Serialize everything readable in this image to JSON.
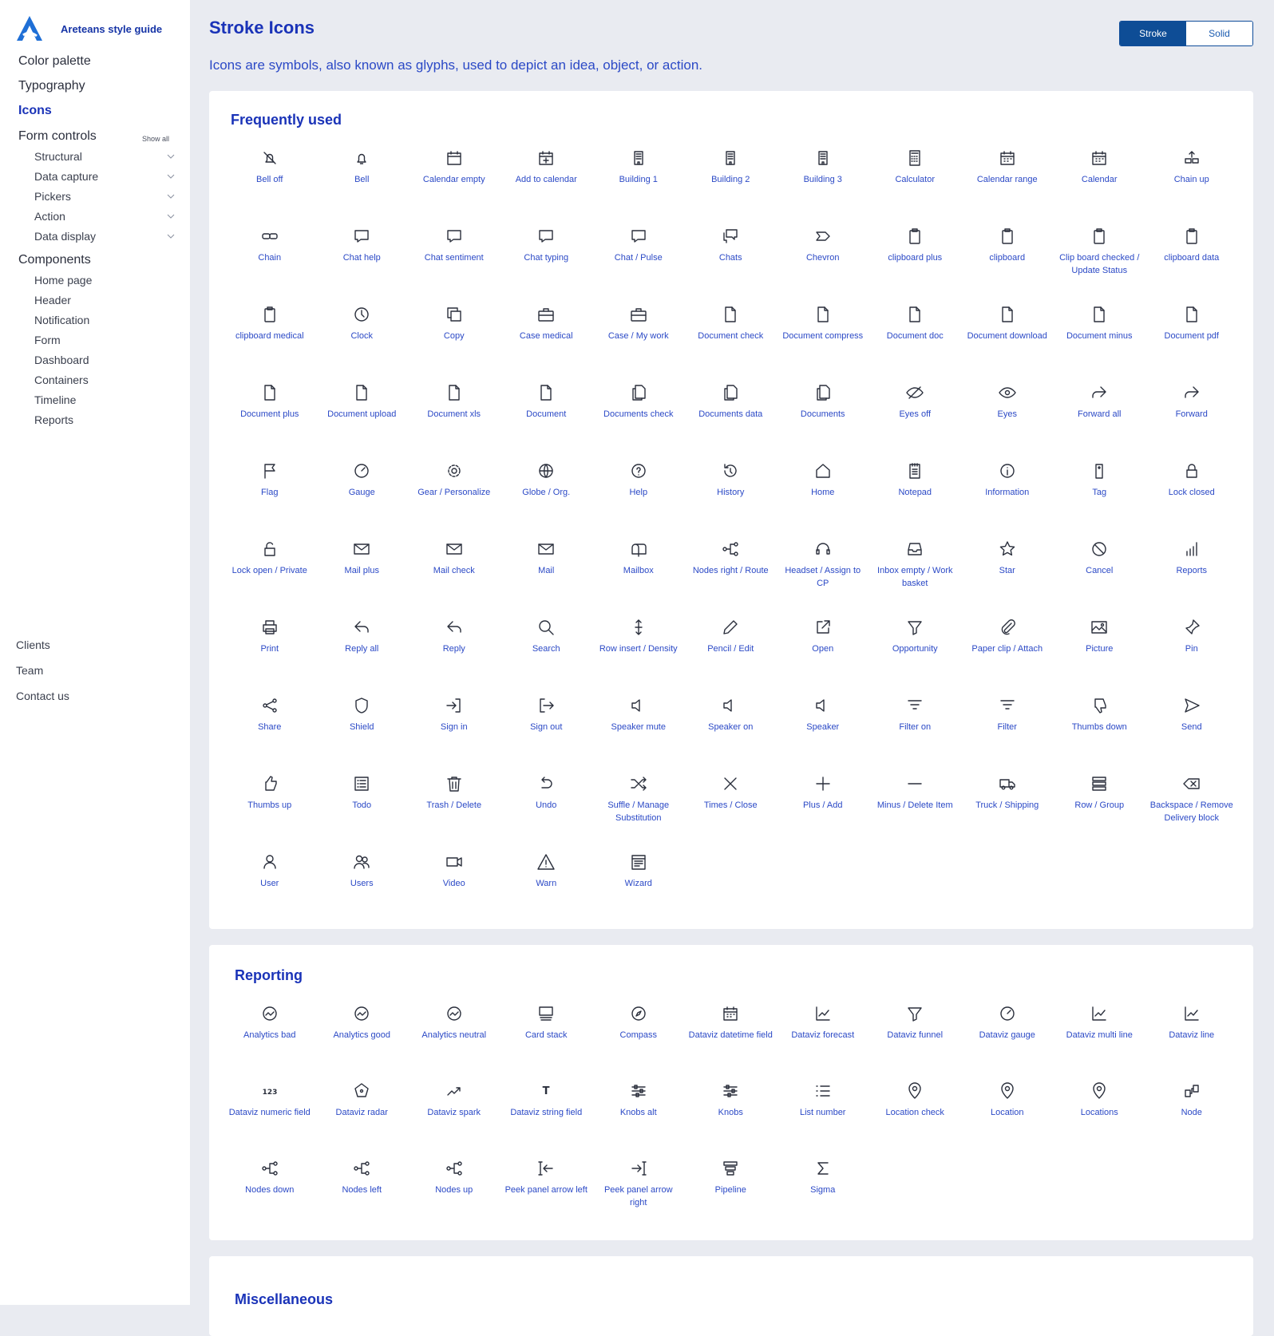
{
  "brand": "Areteans style guide",
  "nav": {
    "top": [
      "Color palette",
      "Typography",
      "Icons"
    ],
    "form_controls": {
      "label": "Form controls",
      "show_all": "Show all",
      "items": [
        "Structural",
        "Data capture",
        "Pickers",
        "Action",
        "Data display"
      ]
    },
    "components": {
      "label": "Components",
      "items": [
        "Home page",
        "Header",
        "Notification",
        "Form",
        "Dashboard",
        "Containers",
        "Timeline",
        "Reports"
      ]
    },
    "bottom": [
      "Clients",
      "Team",
      "Contact us"
    ]
  },
  "header": {
    "title": "Stroke Icons",
    "description": "Icons are symbols, also known as glyphs, used to depict an idea, object, or action.",
    "toggle": {
      "stroke": "Stroke",
      "solid": "Solid",
      "selected": "Stroke"
    }
  },
  "colors": {
    "accent": "#1a33b8",
    "link": "#2b49c6",
    "toggle_active": "#0e4d96",
    "background": "#e9ebf1"
  },
  "sections": [
    {
      "title": "Frequently used",
      "icons": [
        {
          "label": "Bell off",
          "icon": "bell-off"
        },
        {
          "label": "Bell",
          "icon": "bell"
        },
        {
          "label": "Calendar empty",
          "icon": "calendar-empty"
        },
        {
          "label": "Add to calendar",
          "icon": "calendar-plus"
        },
        {
          "label": "Building 1",
          "icon": "building"
        },
        {
          "label": "Building 2",
          "icon": "building"
        },
        {
          "label": "Building 3",
          "icon": "building"
        },
        {
          "label": "Calculator",
          "icon": "calculator"
        },
        {
          "label": "Calendar range",
          "icon": "calendar"
        },
        {
          "label": "Calendar",
          "icon": "calendar"
        },
        {
          "label": "Chain up",
          "icon": "chain-up"
        },
        {
          "label": "Chain",
          "icon": "chain"
        },
        {
          "label": "Chat help",
          "icon": "chat"
        },
        {
          "label": "Chat sentiment",
          "icon": "chat"
        },
        {
          "label": "Chat typing",
          "icon": "chat"
        },
        {
          "label": "Chat / Pulse",
          "icon": "chat"
        },
        {
          "label": "Chats",
          "icon": "chats"
        },
        {
          "label": "Chevron",
          "icon": "chevron"
        },
        {
          "label": "clipboard plus",
          "icon": "clipboard"
        },
        {
          "label": "clipboard",
          "icon": "clipboard"
        },
        {
          "label": "Clip board checked / Update Status",
          "icon": "clipboard"
        },
        {
          "label": "clipboard data",
          "icon": "clipboard"
        },
        {
          "label": "clipboard medical",
          "icon": "clipboard"
        },
        {
          "label": "Clock",
          "icon": "clock"
        },
        {
          "label": "Copy",
          "icon": "copy"
        },
        {
          "label": "Case medical",
          "icon": "briefcase"
        },
        {
          "label": "Case / My work",
          "icon": "briefcase"
        },
        {
          "label": "Document check",
          "icon": "document"
        },
        {
          "label": "Document compress",
          "icon": "document"
        },
        {
          "label": "Document doc",
          "icon": "document"
        },
        {
          "label": "Document download",
          "icon": "document"
        },
        {
          "label": "Document minus",
          "icon": "document"
        },
        {
          "label": "Document pdf",
          "icon": "document"
        },
        {
          "label": "Document plus",
          "icon": "document"
        },
        {
          "label": "Document upload",
          "icon": "document"
        },
        {
          "label": "Document xls",
          "icon": "document"
        },
        {
          "label": "Document",
          "icon": "document"
        },
        {
          "label": "Documents check",
          "icon": "documents"
        },
        {
          "label": "Documents data",
          "icon": "documents"
        },
        {
          "label": "Documents",
          "icon": "documents"
        },
        {
          "label": "Eyes off",
          "icon": "eye-off"
        },
        {
          "label": "Eyes",
          "icon": "eye"
        },
        {
          "label": "Forward all",
          "icon": "forward"
        },
        {
          "label": "Forward",
          "icon": "forward"
        },
        {
          "label": "Flag",
          "icon": "flag"
        },
        {
          "label": "Gauge",
          "icon": "gauge"
        },
        {
          "label": "Gear / Personalize",
          "icon": "gear"
        },
        {
          "label": "Globe / Org.",
          "icon": "globe"
        },
        {
          "label": "Help",
          "icon": "help"
        },
        {
          "label": "History",
          "icon": "history"
        },
        {
          "label": "Home",
          "icon": "home"
        },
        {
          "label": "Notepad",
          "icon": "notepad"
        },
        {
          "label": "Information",
          "icon": "info"
        },
        {
          "label": "Tag",
          "icon": "tag"
        },
        {
          "label": "Lock closed",
          "icon": "lock"
        },
        {
          "label": "Lock open / Private",
          "icon": "lock-open"
        },
        {
          "label": "Mail plus",
          "icon": "mail"
        },
        {
          "label": "Mail check",
          "icon": "mail"
        },
        {
          "label": "Mail",
          "icon": "mail"
        },
        {
          "label": "Mailbox",
          "icon": "mailbox"
        },
        {
          "label": "Nodes right / Route",
          "icon": "nodes"
        },
        {
          "label": "Headset / Assign to CP",
          "icon": "headset"
        },
        {
          "label": "Inbox empty / Work basket",
          "icon": "inbox"
        },
        {
          "label": "Star",
          "icon": "star"
        },
        {
          "label": "Cancel",
          "icon": "cancel"
        },
        {
          "label": "Reports",
          "icon": "bars"
        },
        {
          "label": "Print",
          "icon": "print"
        },
        {
          "label": "Reply all",
          "icon": "reply"
        },
        {
          "label": "Reply",
          "icon": "reply"
        },
        {
          "label": "Search",
          "icon": "search"
        },
        {
          "label": "Row insert / Density",
          "icon": "row-insert"
        },
        {
          "label": "Pencil / Edit",
          "icon": "pencil"
        },
        {
          "label": "Open",
          "icon": "open"
        },
        {
          "label": "Opportunity",
          "icon": "funnel"
        },
        {
          "label": "Paper clip / Attach",
          "icon": "paperclip"
        },
        {
          "label": "Picture",
          "icon": "picture"
        },
        {
          "label": "Pin",
          "icon": "pin"
        },
        {
          "label": "Share",
          "icon": "share"
        },
        {
          "label": "Shield",
          "icon": "shield"
        },
        {
          "label": "Sign in",
          "icon": "sign-in"
        },
        {
          "label": "Sign out",
          "icon": "sign-out"
        },
        {
          "label": "Speaker mute",
          "icon": "speaker"
        },
        {
          "label": "Speaker on",
          "icon": "speaker"
        },
        {
          "label": "Speaker",
          "icon": "speaker"
        },
        {
          "label": "Filter on",
          "icon": "filter"
        },
        {
          "label": "Filter",
          "icon": "filter"
        },
        {
          "label": "Thumbs down",
          "icon": "thumbs-down"
        },
        {
          "label": "Send",
          "icon": "send"
        },
        {
          "label": "Thumbs up",
          "icon": "thumbs-up"
        },
        {
          "label": "Todo",
          "icon": "todo"
        },
        {
          "label": "Trash / Delete",
          "icon": "trash"
        },
        {
          "label": "Undo",
          "icon": "undo"
        },
        {
          "label": "Suffle / Manage Substitution",
          "icon": "shuffle"
        },
        {
          "label": "Times / Close",
          "icon": "times"
        },
        {
          "label": "Plus / Add",
          "icon": "plus"
        },
        {
          "label": "Minus / Delete Item",
          "icon": "minus"
        },
        {
          "label": "Truck / Shipping",
          "icon": "truck"
        },
        {
          "label": "Row / Group",
          "icon": "rows"
        },
        {
          "label": "Backspace / Remove Delivery block",
          "icon": "backspace"
        },
        {
          "label": "User",
          "icon": "user"
        },
        {
          "label": "Users",
          "icon": "users"
        },
        {
          "label": "Video",
          "icon": "video"
        },
        {
          "label": "Warn",
          "icon": "warn"
        },
        {
          "label": "Wizard",
          "icon": "wizard"
        }
      ]
    },
    {
      "title": "Reporting",
      "icons": [
        {
          "label": "Analytics bad",
          "icon": "analytics"
        },
        {
          "label": "Analytics good",
          "icon": "analytics"
        },
        {
          "label": "Analytics neutral",
          "icon": "analytics"
        },
        {
          "label": "Card stack",
          "icon": "card-stack"
        },
        {
          "label": "Compass",
          "icon": "compass"
        },
        {
          "label": "Dataviz datetime field",
          "icon": "calendar"
        },
        {
          "label": "Dataviz forecast",
          "icon": "line-chart"
        },
        {
          "label": "Dataviz funnel",
          "icon": "funnel"
        },
        {
          "label": "Dataviz gauge",
          "icon": "gauge"
        },
        {
          "label": "Dataviz multi line",
          "icon": "line-chart"
        },
        {
          "label": "Dataviz line",
          "icon": "line-chart"
        },
        {
          "label": "Dataviz numeric field",
          "icon": "numeric",
          "glyph": "123"
        },
        {
          "label": "Dataviz radar",
          "icon": "radar"
        },
        {
          "label": "Dataviz spark",
          "icon": "spark"
        },
        {
          "label": "Dataviz string field",
          "icon": "string",
          "glyph": "T"
        },
        {
          "label": "Knobs alt",
          "icon": "knobs"
        },
        {
          "label": "Knobs",
          "icon": "knobs"
        },
        {
          "label": "List number",
          "icon": "list"
        },
        {
          "label": "Location check",
          "icon": "location"
        },
        {
          "label": "Location",
          "icon": "location"
        },
        {
          "label": "Locations",
          "icon": "location"
        },
        {
          "label": "Node",
          "icon": "node"
        },
        {
          "label": "Nodes down",
          "icon": "nodes"
        },
        {
          "label": "Nodes left",
          "icon": "nodes"
        },
        {
          "label": "Nodes up",
          "icon": "nodes"
        },
        {
          "label": "Peek panel arrow left",
          "icon": "peek-left"
        },
        {
          "label": "Peek panel arrow right",
          "icon": "peek-right"
        },
        {
          "label": "Pipeline",
          "icon": "pipeline"
        },
        {
          "label": "Sigma",
          "icon": "sigma"
        }
      ]
    },
    {
      "title": "Miscellaneous",
      "icons": []
    }
  ]
}
